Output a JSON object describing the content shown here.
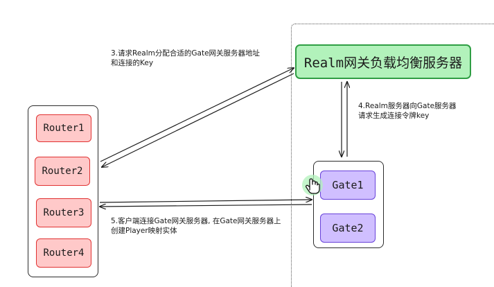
{
  "realm": {
    "label": "Realm网关负载均衡服务器"
  },
  "routers": [
    {
      "label": "Router1"
    },
    {
      "label": "Router2"
    },
    {
      "label": "Router3"
    },
    {
      "label": "Router4"
    }
  ],
  "gates": [
    {
      "label": "Gate1"
    },
    {
      "label": "Gate2"
    }
  ],
  "notes": {
    "step3": {
      "line1": "3.请求Realm分配合适的Gate网关服务器地址",
      "line2": "和连接的Key"
    },
    "step4": {
      "line1": "4.Realm服务器向Gate服务器",
      "line2": "请求生成连接令牌key"
    },
    "step5": {
      "line1": "5.客户端连接Gate网关服务器, 在Gate网关服务器上",
      "line2": "创建Player映射实体"
    }
  },
  "colors": {
    "router_fill": "#ffc9c9",
    "router_stroke": "#e03131",
    "gate_fill": "#d0bfff",
    "gate_stroke": "#6741d9",
    "realm_fill": "#b2f2bb",
    "realm_stroke": "#2f9e44",
    "line": "#1a1a1a"
  },
  "icons": {
    "cursor": "hand-pointer-icon"
  }
}
